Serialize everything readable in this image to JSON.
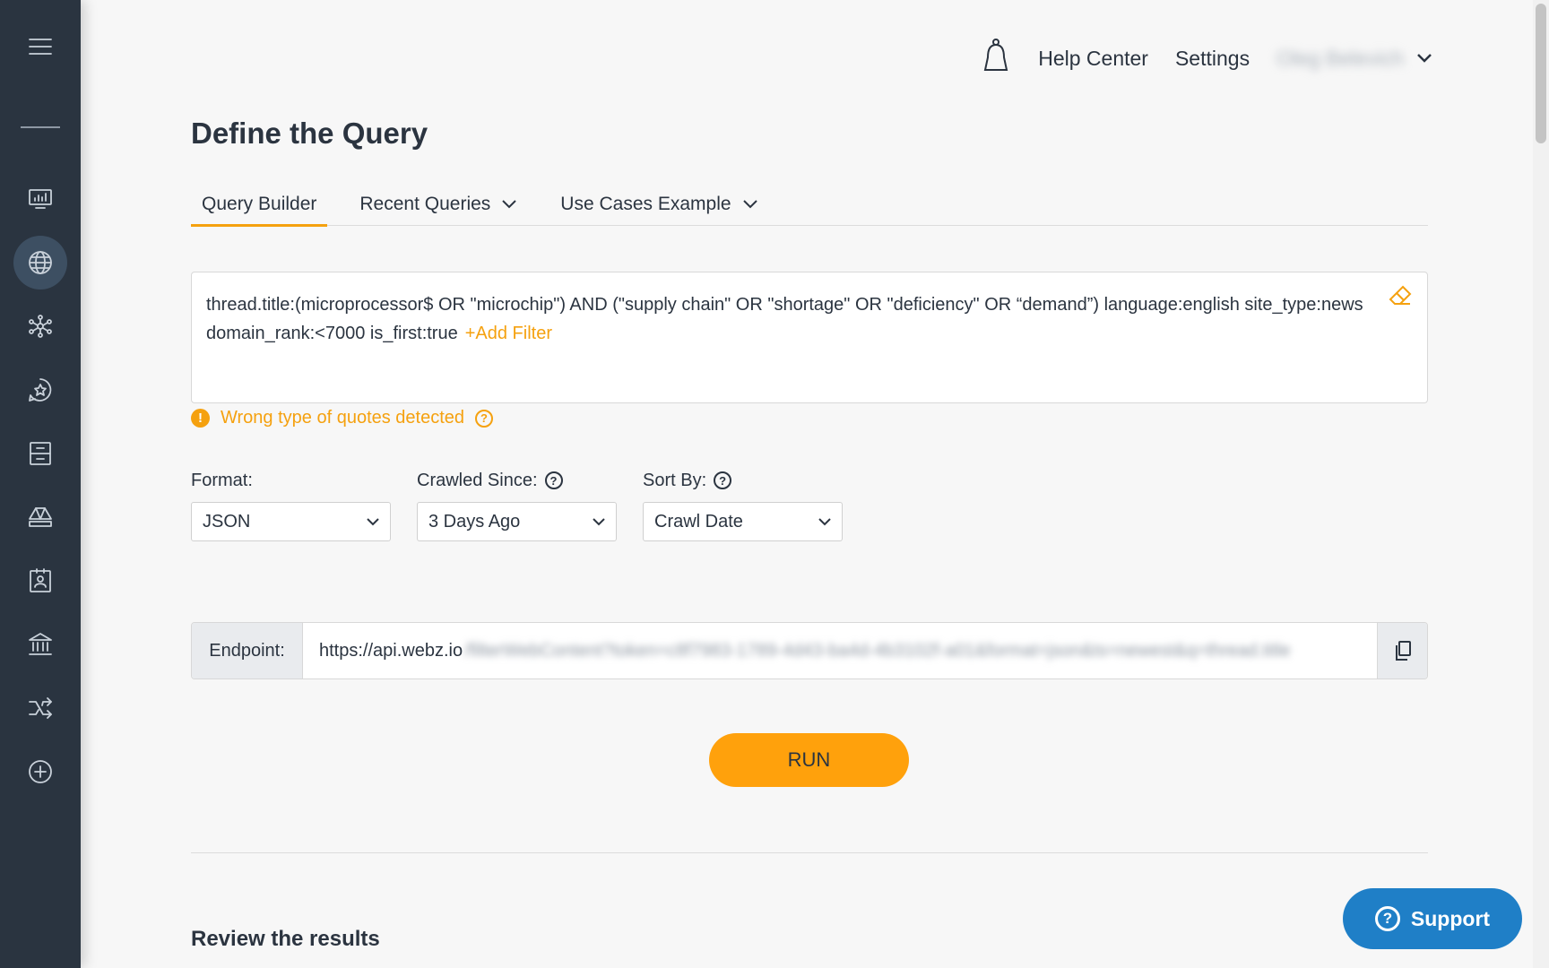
{
  "sidebar": {
    "items": [
      {
        "icon": "menu-icon"
      },
      {
        "icon": "dashboard-icon"
      },
      {
        "icon": "globe-icon",
        "active": true
      },
      {
        "icon": "network-icon"
      },
      {
        "icon": "star-badge-icon"
      },
      {
        "icon": "archive-icon"
      },
      {
        "icon": "diamond-icon"
      },
      {
        "icon": "id-card-icon"
      },
      {
        "icon": "bank-icon"
      },
      {
        "icon": "shuffle-icon"
      },
      {
        "icon": "add-icon"
      }
    ]
  },
  "header": {
    "help_center": "Help Center",
    "settings": "Settings",
    "user_name": "Oleg Belevich"
  },
  "page": {
    "title": "Define the Query",
    "tabs": [
      {
        "label": "Query Builder",
        "active": true
      },
      {
        "label": "Recent Queries"
      },
      {
        "label": "Use Cases Example"
      }
    ]
  },
  "query": {
    "text": "thread.title:(microprocessor$ OR \"microchip\") AND (\"supply chain\" OR \"shortage\" OR \"deficiency\" OR “demand”) language:english site_type:news domain_rank:<7000 is_first:true",
    "add_filter": "+Add Filter",
    "warning": "Wrong type of quotes detected"
  },
  "fields": {
    "format": {
      "label": "Format:",
      "value": "JSON"
    },
    "crawled_since": {
      "label": "Crawled Since:",
      "value": "3 Days Ago"
    },
    "sort_by": {
      "label": "Sort By:",
      "value": "Crawl Date"
    }
  },
  "endpoint": {
    "label": "Endpoint:",
    "url_visible": "https://api.webz.io",
    "url_blurred": "/filterWebContent?token=c8f7983-1789-4d43-ba4d-4b3102f-a01&format=json&ts=newest&q=thread.title"
  },
  "actions": {
    "run": "RUN",
    "support": "Support"
  },
  "results": {
    "title": "Review the results"
  },
  "colors": {
    "accent": "#ffa10c",
    "sidebar_bg": "#2a3440",
    "support_bg": "#1f7fc7"
  }
}
